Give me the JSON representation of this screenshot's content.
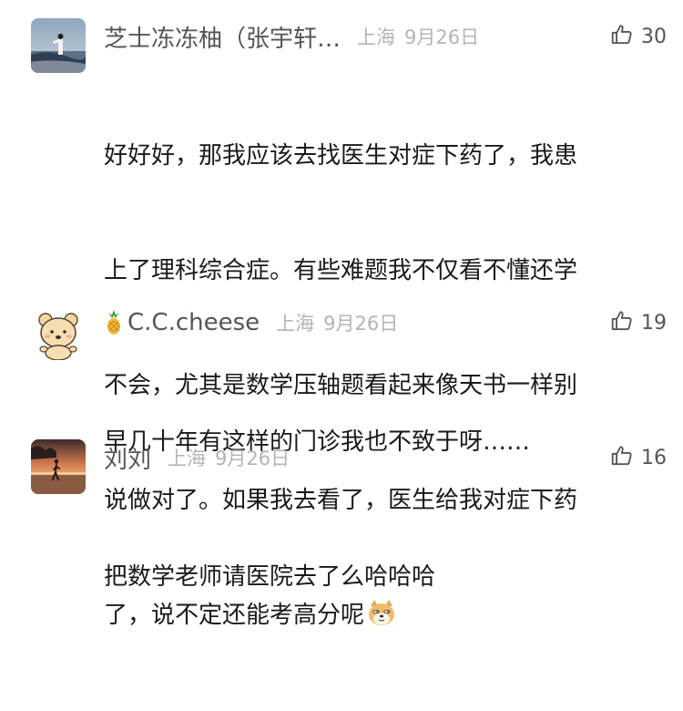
{
  "comments": [
    {
      "username": "芝士冻冻柚（张宇轩…",
      "location": "上海",
      "date": "9月26日",
      "likes": "30",
      "lines": [
        "好好好，那我应该去找医生对症下药了，我患",
        "上了理科综合症。有些难题我不仅看不懂还学",
        "不会，尤其是数学压轴题看起来像天书一样别",
        "说做对了。如果我去看了，医生给我对症下药",
        "了，说不定还能考高分呢"
      ],
      "trailing_emoji": "doge-emoji"
    },
    {
      "username_prefix_icon": "pineapple-icon",
      "username": "C.C.cheese",
      "location": "上海",
      "date": "9月26日",
      "likes": "19",
      "lines": [
        "早几十年有这样的门诊我也不致于呀……"
      ]
    },
    {
      "username": "刘刘",
      "location": "上海",
      "date": "9月26日",
      "likes": "16",
      "lines": [
        "把数学老师请医院去了么哈哈哈"
      ]
    }
  ],
  "icons": {
    "like": "thumbs-up-icon"
  },
  "colors": {
    "username": "#555555",
    "meta": "#b4b4b4",
    "text": "#1a1a1a"
  }
}
